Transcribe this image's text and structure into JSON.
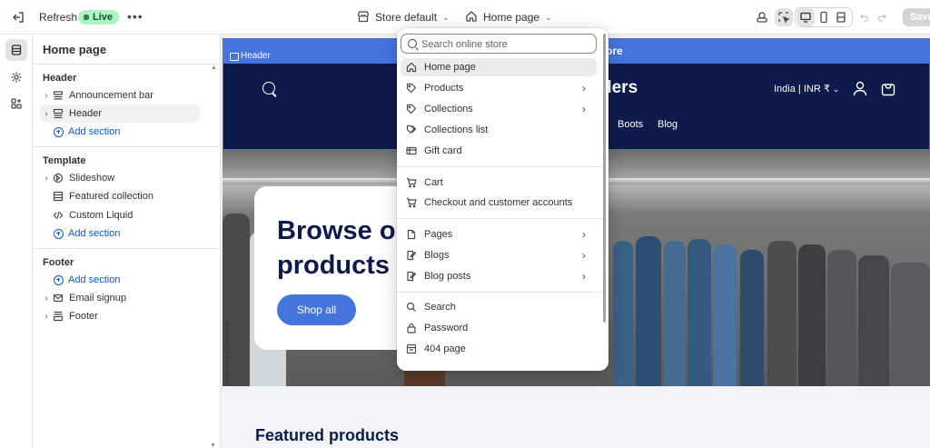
{
  "topbar": {
    "refresh_label": "Refresh",
    "live_badge": "Live",
    "more_label": "•••",
    "store_selector": "Store default",
    "page_selector": "Home page",
    "save_label": "Save"
  },
  "sidebar": {
    "title": "Home page",
    "header_group": {
      "label": "Header",
      "items": [
        "Announcement bar",
        "Header"
      ],
      "add_label": "Add section"
    },
    "template_group": {
      "label": "Template",
      "items": [
        "Slideshow",
        "Featured collection",
        "Custom Liquid"
      ],
      "add_label": "Add section"
    },
    "footer_group": {
      "label": "Footer",
      "add_label": "Add section",
      "items": [
        "Email signup",
        "Footer"
      ]
    }
  },
  "preview": {
    "announcement_visible": "tore",
    "header_tag": "Header",
    "logo_visible": "ders",
    "locale": "India | INR ₹",
    "nav": [
      "Boots",
      "Blog"
    ],
    "hero_title": "Browse o products",
    "hero_button": "Shop all",
    "image_credit": "Adobe Stock | #312203530",
    "featured_title": "Featured products"
  },
  "dropdown": {
    "search_placeholder": "Search online store",
    "group1": [
      {
        "label": "Home page",
        "icon": "home-icon",
        "has_arrow": false
      },
      {
        "label": "Products",
        "icon": "tag-icon",
        "has_arrow": true
      },
      {
        "label": "Collections",
        "icon": "tag-icon",
        "has_arrow": true
      },
      {
        "label": "Collections list",
        "icon": "tags-icon",
        "has_arrow": false
      },
      {
        "label": "Gift card",
        "icon": "gift-card-icon",
        "has_arrow": false
      }
    ],
    "group2": [
      {
        "label": "Cart",
        "icon": "cart-icon",
        "has_arrow": false
      },
      {
        "label": "Checkout and customer accounts",
        "icon": "cart-icon",
        "has_arrow": false
      }
    ],
    "group3": [
      {
        "label": "Pages",
        "icon": "page-icon",
        "has_arrow": true
      },
      {
        "label": "Blogs",
        "icon": "blog-icon",
        "has_arrow": true
      },
      {
        "label": "Blog posts",
        "icon": "blog-icon",
        "has_arrow": true
      }
    ],
    "group4": [
      {
        "label": "Search",
        "icon": "search-icon",
        "has_arrow": false
      },
      {
        "label": "Password",
        "icon": "lock-icon",
        "has_arrow": false
      },
      {
        "label": "404 page",
        "icon": "page-404-icon",
        "has_arrow": false
      }
    ]
  },
  "colors": {
    "accent": "#4574dc",
    "header_bg": "#0e1a4b",
    "live_bg": "#aff2c4",
    "link": "#005bd3"
  }
}
